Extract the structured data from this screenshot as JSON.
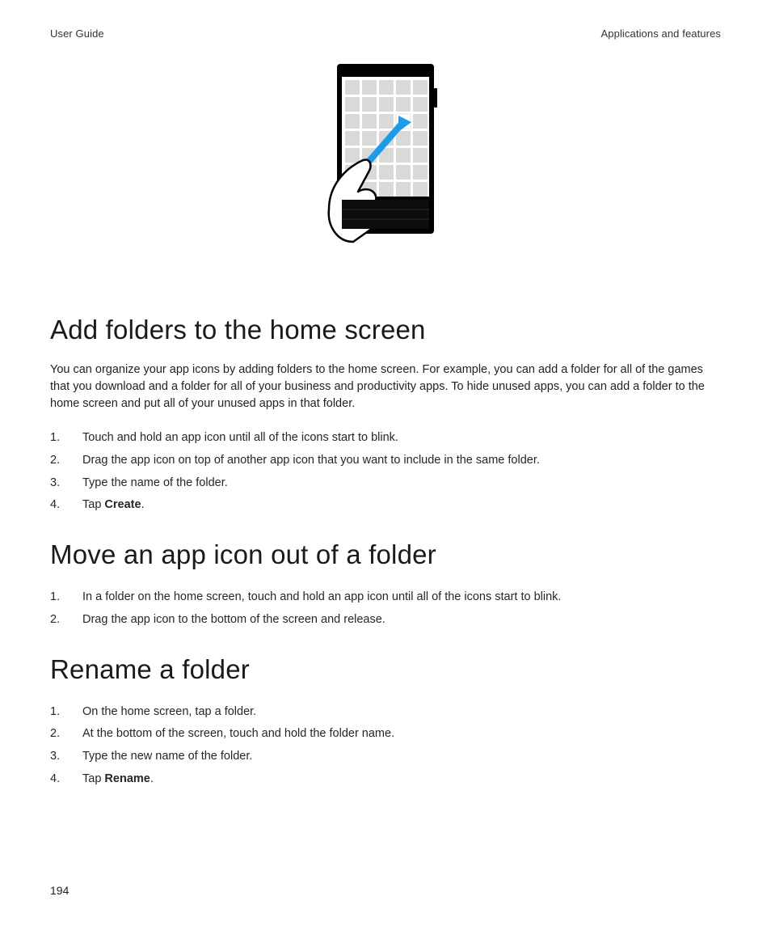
{
  "header": {
    "left": "User Guide",
    "right": "Applications and features"
  },
  "page_number": "194",
  "sections": {
    "add_folders": {
      "title": "Add folders to the home screen",
      "lead": "You can organize your app icons by adding folders to the home screen. For example, you can add a folder for all of the games that you download and a folder for all of your business and productivity apps. To hide unused apps, you can add a folder to the home screen and put all of your unused apps in that folder.",
      "steps": [
        "Touch and hold an app icon until all of the icons start to blink.",
        "Drag the app icon on top of another app icon that you want to include in the same folder.",
        "Type the name of the folder.",
        "Tap "
      ],
      "step4_bold": "Create",
      "step4_suffix": "."
    },
    "move_out": {
      "title": "Move an app icon out of a folder",
      "steps": [
        "In a folder on the home screen, touch and hold an app icon until all of the icons start to blink.",
        "Drag the app icon to the bottom of the screen and release."
      ]
    },
    "rename": {
      "title": "Rename a folder",
      "steps": [
        "On the home screen, tap a folder.",
        "At the bottom of the screen, touch and hold the folder name.",
        "Type the new name of the folder.",
        "Tap "
      ],
      "step4_bold": "Rename",
      "step4_suffix": "."
    }
  }
}
